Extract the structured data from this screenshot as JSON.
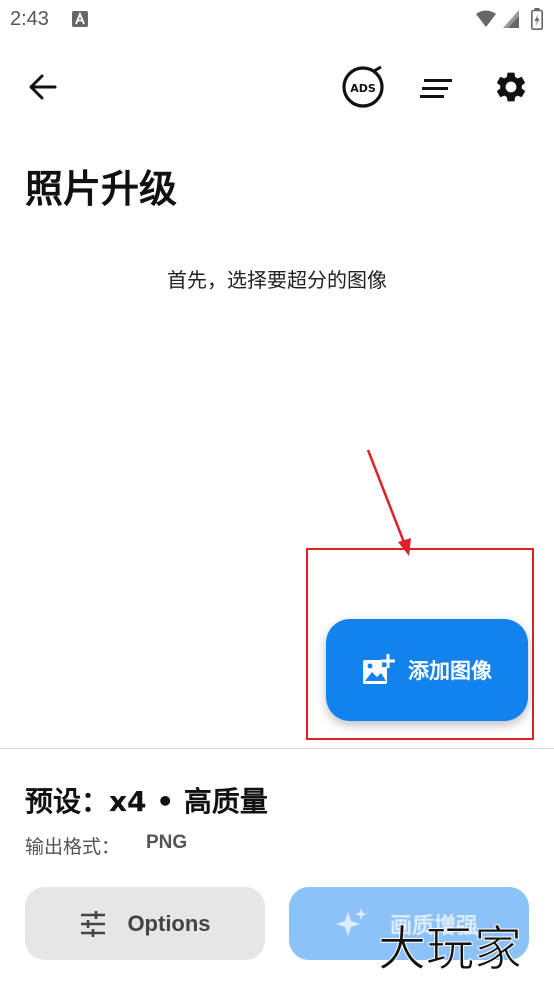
{
  "status_bar": {
    "time": "2:43",
    "notification_icon": "a-notification-icon",
    "wifi_icon": "wifi-icon",
    "signal_icon": "signal-icon",
    "battery_icon": "battery-charging-icon"
  },
  "toolbar": {
    "back_icon": "arrow-left-icon",
    "ads_text": "ADS",
    "ads_icon": "no-ads-icon",
    "sort_icon": "sort-lines-icon",
    "settings_icon": "gear-icon"
  },
  "page": {
    "title": "照片升级",
    "hint": "首先，选择要超分的图像"
  },
  "fab": {
    "label": "添加图像",
    "icon": "add-photo-icon"
  },
  "preset": {
    "text": "预设：x4 • 高质量"
  },
  "output": {
    "label": "输出格式：",
    "value": "PNG"
  },
  "actions": {
    "options_label": "Options",
    "options_icon": "sliders-icon",
    "enhance_label": "画质增强",
    "enhance_icon": "sparkle-icon"
  },
  "annotation": {
    "color": "#e0202a"
  },
  "watermark": {
    "text": "大玩家"
  },
  "colors": {
    "accent": "#1282ee",
    "accent_disabled": "#8cc2f7",
    "options_bg": "#e6e6e6"
  }
}
